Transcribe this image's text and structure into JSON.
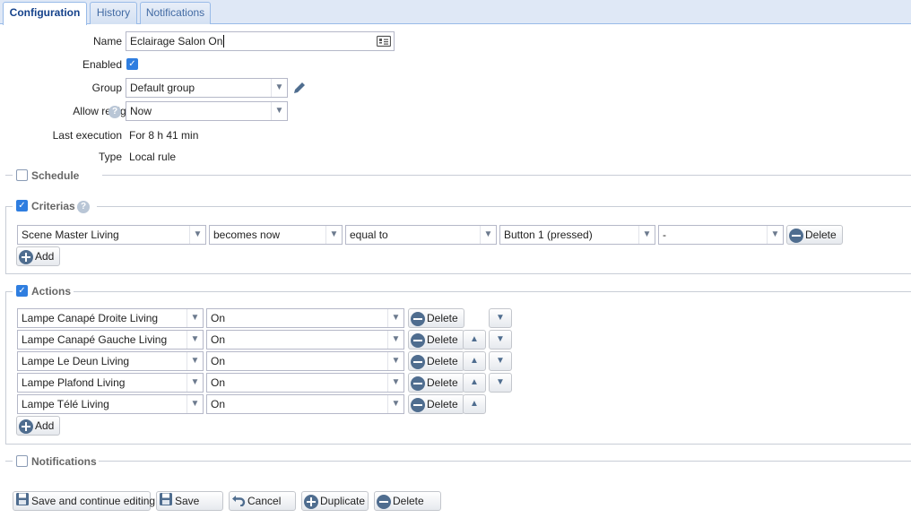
{
  "tabs": [
    {
      "label": "Configuration"
    },
    {
      "label": "History"
    },
    {
      "label": "Notifications"
    }
  ],
  "form": {
    "name_label": "Name",
    "name_value": "Eclairage Salon On",
    "enabled_label": "Enabled",
    "group_label": "Group",
    "group_value": "Default group",
    "retrigger_label": "Allow retrigger",
    "retrigger_value": "Now",
    "last_exec_label": "Last execution",
    "last_exec_value": "For 8 h 41 min",
    "type_label": "Type",
    "type_value": "Local rule"
  },
  "sections": {
    "schedule": "Schedule",
    "criterias": "Criterias",
    "actions": "Actions",
    "notifications": "Notifications"
  },
  "criteria": {
    "device": "Scene Master Living",
    "event": "becomes now",
    "operator": "equal to",
    "value": "Button 1 (pressed)",
    "extra": "-",
    "delete_label": "Delete",
    "add_label": "Add"
  },
  "actions": {
    "rows": [
      {
        "device": "Lampe Canapé Droite Living",
        "state": "On"
      },
      {
        "device": "Lampe Canapé Gauche Living",
        "state": "On"
      },
      {
        "device": "Lampe Le Deun Living",
        "state": "On"
      },
      {
        "device": "Lampe Plafond Living",
        "state": "On"
      },
      {
        "device": "Lampe Télé Living",
        "state": "On"
      }
    ],
    "delete_label": "Delete",
    "add_label": "Add"
  },
  "footer": {
    "save_continue": "Save and continue editing",
    "save": "Save",
    "cancel": "Cancel",
    "duplicate": "Duplicate",
    "delete": "Delete"
  }
}
